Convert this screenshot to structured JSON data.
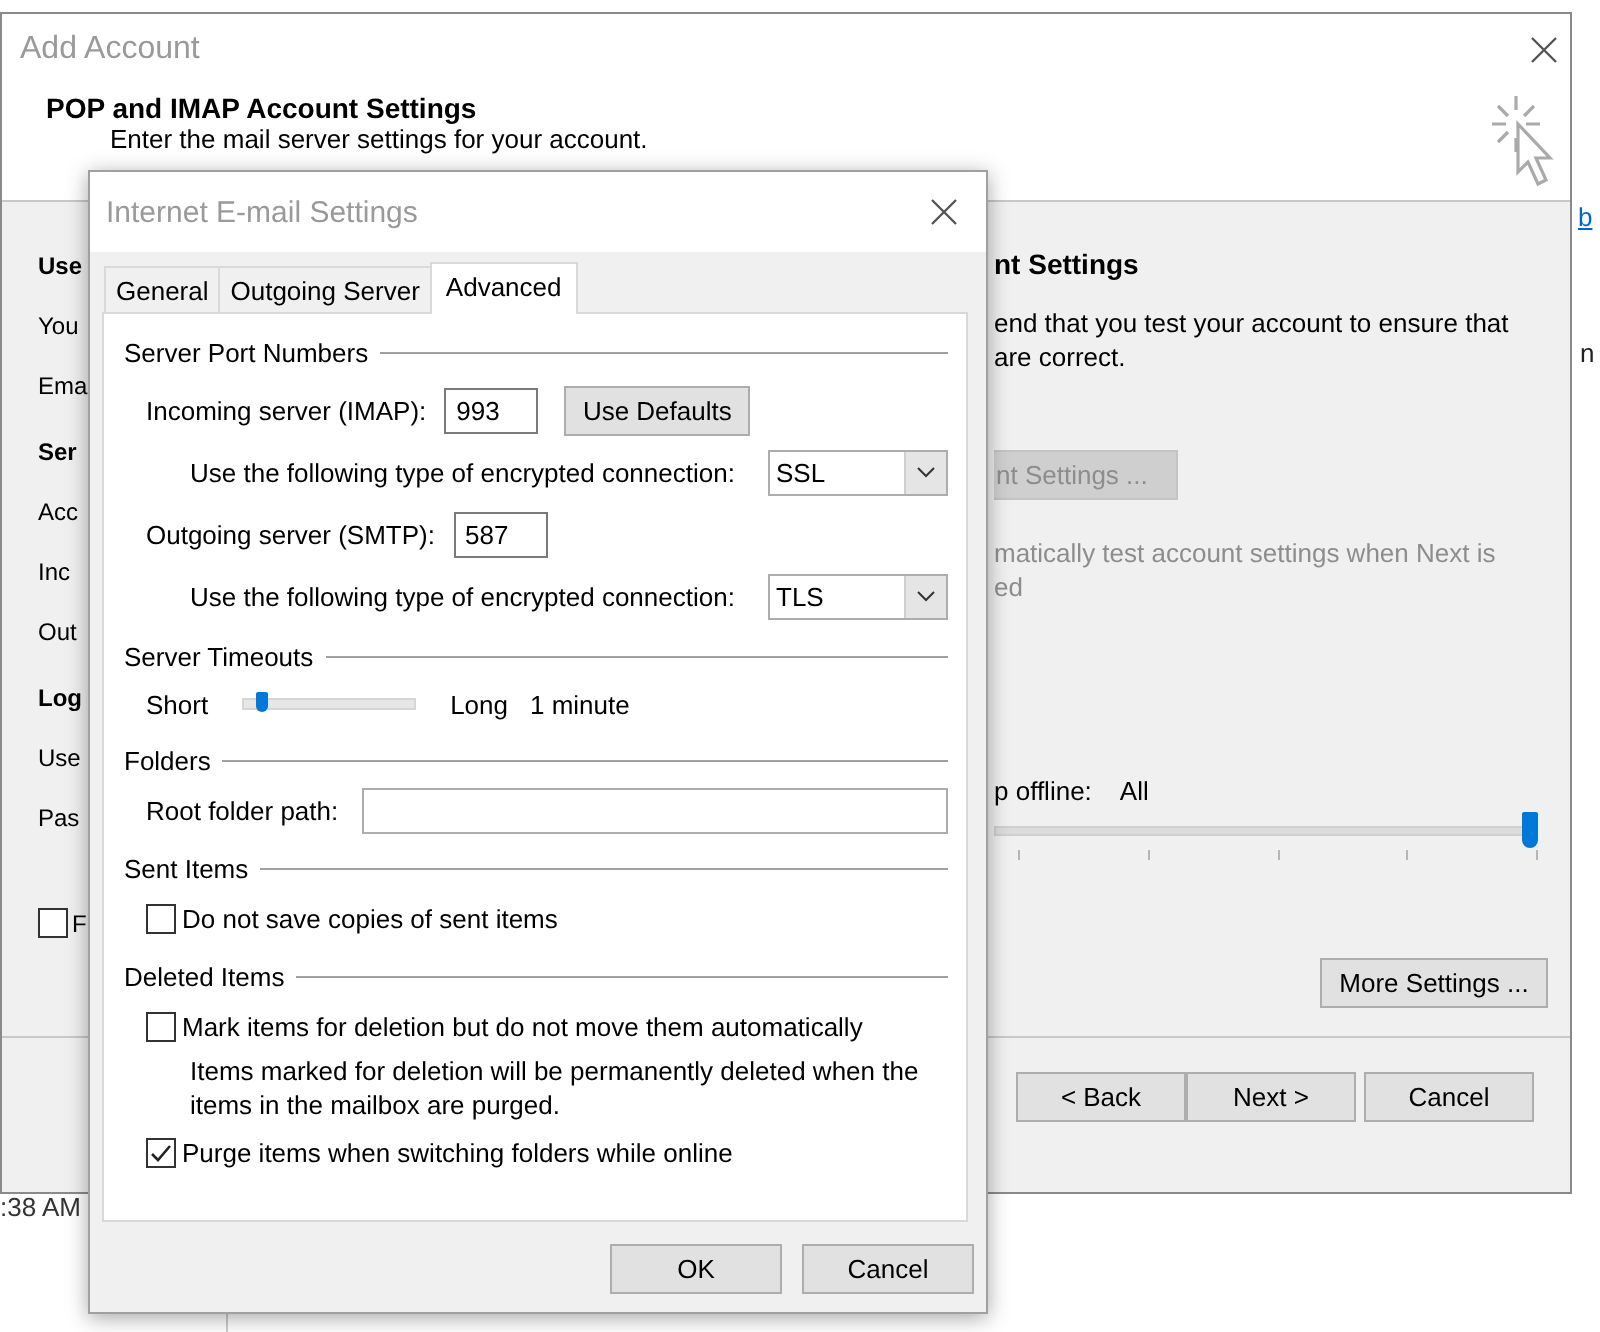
{
  "background": {
    "link_fragment": "b",
    "text_fragment": "n",
    "clock_fragment": ":38 AM"
  },
  "add_account": {
    "title": "Add Account",
    "heading": "POP and IMAP Account Settings",
    "subheading": "Enter the mail server settings for your account.",
    "left_column": [
      {
        "kind": "heading",
        "text": "Use"
      },
      {
        "kind": "label",
        "text": "You"
      },
      {
        "kind": "label",
        "text": "Ema"
      },
      {
        "kind": "heading",
        "text": "Ser"
      },
      {
        "kind": "label",
        "text": "Acc"
      },
      {
        "kind": "label",
        "text": "Inc"
      },
      {
        "kind": "label",
        "text": "Out"
      },
      {
        "kind": "heading",
        "text": "Log"
      },
      {
        "kind": "label",
        "text": "Use"
      },
      {
        "kind": "label",
        "text": "Pas"
      },
      {
        "kind": "checkbox",
        "text": "F",
        "checked": false
      }
    ],
    "right_column": {
      "heading": "nt Settings",
      "description": [
        "end that you test your account to ensure that",
        "are correct."
      ],
      "test_button": {
        "label": "nt Settings ...",
        "disabled": true
      },
      "auto_test": {
        "lines": [
          "matically test account settings when Next is",
          "ed"
        ],
        "disabled": true
      },
      "offline_label": "p offline:",
      "offline_value": "All",
      "offline_slider": {
        "level": 1
      },
      "more_settings_button": "More Settings ..."
    },
    "buttons": [
      "< Back",
      "Next >",
      "Cancel"
    ]
  },
  "dialog": {
    "title": "Internet E-mail Settings",
    "tabs": [
      {
        "label": "General",
        "selected": false
      },
      {
        "label": "Outgoing Server",
        "selected": false
      },
      {
        "label": "Advanced",
        "selected": true
      }
    ],
    "sections": [
      {
        "title": "Server Port Numbers",
        "rows": [
          {
            "kind": "port",
            "label": "Incoming server (IMAP):",
            "value": "993",
            "button": "Use Defaults"
          },
          {
            "kind": "select",
            "label": "Use the following type of encrypted connection:",
            "value": "SSL"
          },
          {
            "kind": "port",
            "label": "Outgoing server (SMTP):",
            "value": "587"
          },
          {
            "kind": "select",
            "label": "Use the following type of encrypted connection:",
            "value": "TLS"
          }
        ]
      },
      {
        "title": "Server Timeouts",
        "rows": [
          {
            "kind": "slider",
            "min_label": "Short",
            "max_label": "Long",
            "level": 0.1,
            "reading": "1 minute"
          }
        ]
      },
      {
        "title": "Folders",
        "rows": [
          {
            "kind": "text",
            "label": "Root folder path:"
          }
        ]
      },
      {
        "title": "Sent Items",
        "rows": [
          {
            "kind": "checkbox",
            "label": "Do not save copies of sent items",
            "checked": false
          }
        ]
      },
      {
        "title": "Deleted Items",
        "rows": [
          {
            "kind": "checkbox",
            "label": "Mark items for deletion but do not move them automatically",
            "checked": false
          },
          {
            "kind": "note",
            "text": "Items marked for deletion will be permanently deleted when the items in the mailbox are purged."
          },
          {
            "kind": "checkbox",
            "label": "Purge items when switching folders while online",
            "checked": true
          }
        ]
      }
    ],
    "buttons": [
      "OK",
      "Cancel"
    ]
  }
}
